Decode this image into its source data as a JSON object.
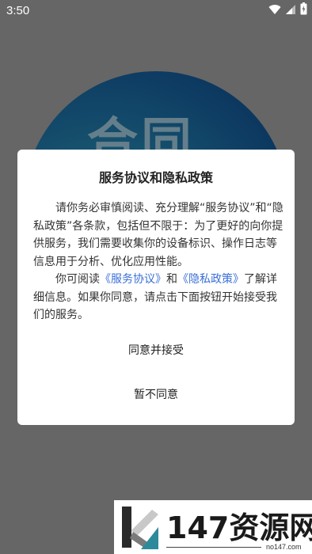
{
  "status_bar": {
    "time": "3:50"
  },
  "splash": {
    "logo_text": "合同"
  },
  "dialog": {
    "title": "服务协议和隐私政策",
    "paragraph1": "请你务必审慎阅读、充分理解“服务协议”和“隐私政策”各条款，包括但不限于：为了更好的向你提供服务，我们需要收集你的设备标识、操作日志等信息用于分析、优化应用性能。",
    "paragraph2_prefix": "你可阅读",
    "service_link": "《服务协议》",
    "and_text": "和",
    "privacy_link": "《隐私政策》",
    "paragraph2_suffix": "了解详细信息。如果你同意，请点击下面按钮开始接受我们的服务。",
    "agree_button": "同意并接受",
    "disagree_button": "暂不同意"
  },
  "watermark": {
    "text": "147资源网",
    "url": "no147.com"
  },
  "colors": {
    "background": "#6f6f6f",
    "link": "#3a6fd8",
    "dialog_bg": "#ffffff"
  },
  "icons": [
    "wifi-icon",
    "signal-icon",
    "battery-icon"
  ]
}
